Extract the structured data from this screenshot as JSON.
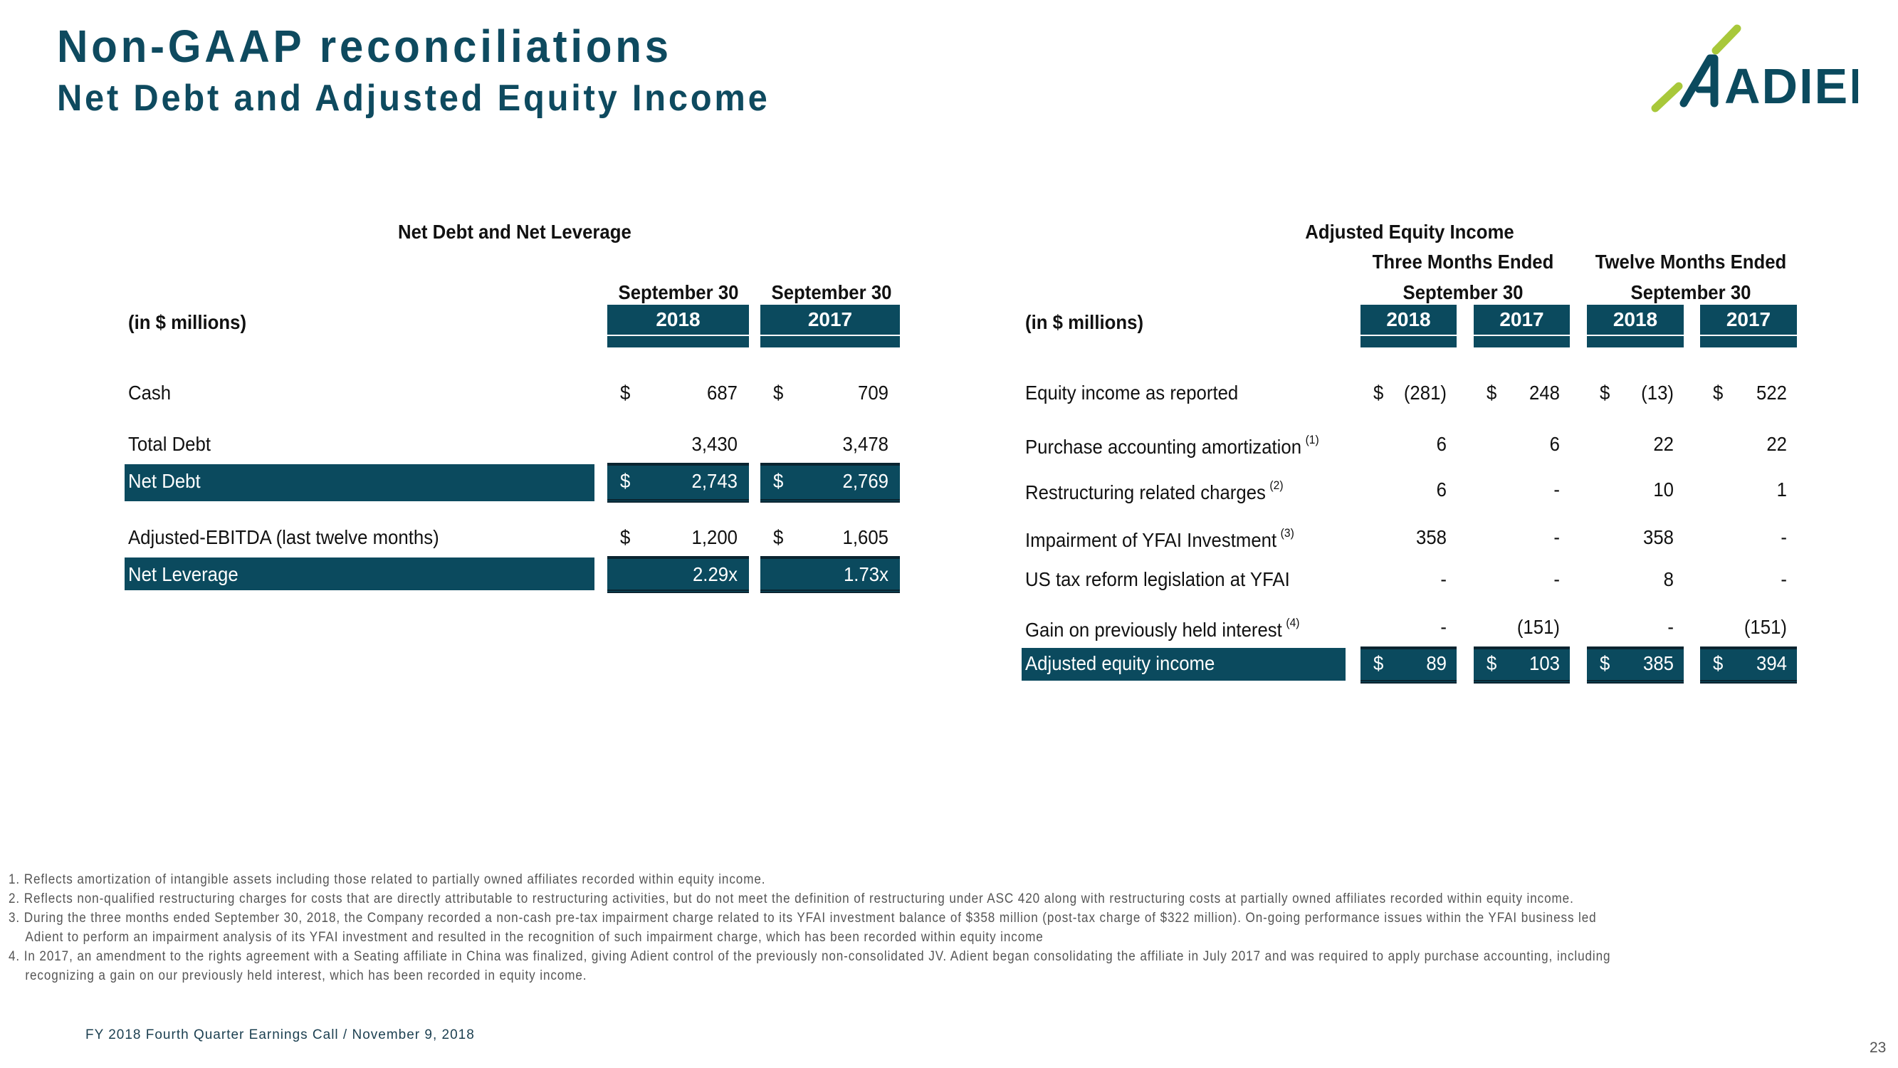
{
  "header": {
    "title": "Non-GAAP reconciliations",
    "subtitle": "Net Debt and Adjusted Equity Income",
    "logo_text": "ADIENT",
    "brand_colors": {
      "navy": "#0b4a5e",
      "lime": "#a8c83a"
    }
  },
  "net_debt": {
    "title": "Net Debt and Net Leverage",
    "units_label": "(in $ millions)",
    "period_label": "September 30",
    "columns": [
      "2018",
      "2017"
    ],
    "rows": [
      {
        "label": "Cash",
        "cells": [
          {
            "cur": "$",
            "val": "687"
          },
          {
            "cur": "$",
            "val": "709"
          }
        ],
        "highlight": false
      },
      {
        "label": "Total Debt",
        "cells": [
          {
            "cur": "",
            "val": "3,430"
          },
          {
            "cur": "",
            "val": "3,478"
          }
        ],
        "highlight": false
      },
      {
        "label": "Net Debt",
        "cells": [
          {
            "cur": "$",
            "val": "2,743"
          },
          {
            "cur": "$",
            "val": "2,769"
          }
        ],
        "highlight": true
      },
      {
        "label": "Adjusted-EBITDA (last twelve months)",
        "cells": [
          {
            "cur": "$",
            "val": "1,200"
          },
          {
            "cur": "$",
            "val": "1,605"
          }
        ],
        "highlight": false
      },
      {
        "label": "Net Leverage",
        "cells": [
          {
            "cur": "",
            "val": "2.29x"
          },
          {
            "cur": "",
            "val": "1.73x"
          }
        ],
        "highlight": true
      }
    ]
  },
  "equity_income": {
    "title": "Adjusted Equity Income",
    "units_label": "(in $ millions)",
    "groups": [
      {
        "label": "Three Months Ended",
        "period": "September 30"
      },
      {
        "label": "Twelve Months Ended",
        "period": "September 30"
      }
    ],
    "columns": [
      "2018",
      "2017",
      "2018",
      "2017"
    ],
    "rows": [
      {
        "label": "Equity income as reported",
        "fn": "",
        "cells": [
          {
            "cur": "$",
            "val": "(281)"
          },
          {
            "cur": "$",
            "val": "248"
          },
          {
            "cur": "$",
            "val": "(13)"
          },
          {
            "cur": "$",
            "val": "522"
          }
        ]
      },
      {
        "label": "Purchase accounting amortization",
        "fn": "(1)",
        "cells": [
          {
            "cur": "",
            "val": "6"
          },
          {
            "cur": "",
            "val": "6"
          },
          {
            "cur": "",
            "val": "22"
          },
          {
            "cur": "",
            "val": "22"
          }
        ]
      },
      {
        "label": "Restructuring related charges",
        "fn": "(2)",
        "cells": [
          {
            "cur": "",
            "val": "6"
          },
          {
            "cur": "",
            "val": "-"
          },
          {
            "cur": "",
            "val": "10"
          },
          {
            "cur": "",
            "val": "1"
          }
        ]
      },
      {
        "label": "Impairment of YFAI Investment",
        "fn": "(3)",
        "cells": [
          {
            "cur": "",
            "val": "358"
          },
          {
            "cur": "",
            "val": "-"
          },
          {
            "cur": "",
            "val": "358"
          },
          {
            "cur": "",
            "val": "-"
          }
        ]
      },
      {
        "label": "US tax reform legislation at YFAI",
        "fn": "",
        "cells": [
          {
            "cur": "",
            "val": "-"
          },
          {
            "cur": "",
            "val": "-"
          },
          {
            "cur": "",
            "val": "8"
          },
          {
            "cur": "",
            "val": "-"
          }
        ]
      },
      {
        "label": "Gain on previously held interest",
        "fn": "(4)",
        "cells": [
          {
            "cur": "",
            "val": "-"
          },
          {
            "cur": "",
            "val": "(151)"
          },
          {
            "cur": "",
            "val": "-"
          },
          {
            "cur": "",
            "val": "(151)"
          }
        ]
      }
    ],
    "total": {
      "label": "Adjusted equity income",
      "cells": [
        {
          "cur": "$",
          "val": "89"
        },
        {
          "cur": "$",
          "val": "103"
        },
        {
          "cur": "$",
          "val": "385"
        },
        {
          "cur": "$",
          "val": "394"
        }
      ]
    }
  },
  "footnotes": [
    "1. Reflects amortization of intangible assets including those related to partially owned affiliates recorded within equity income.",
    "2. Reflects non-qualified restructuring charges for costs that are directly attributable to restructuring activities, but do not meet the definition of restructuring under ASC 420 along with restructuring costs at partially owned affiliates recorded within equity income.",
    "3. During the three months ended September 30, 2018, the Company recorded a non-cash pre-tax impairment charge related to its YFAI investment balance of $358 million (post-tax charge of $322 million). On-going performance issues within the YFAI business led",
    "Adient to perform an impairment analysis of its YFAI investment and resulted in the recognition of such impairment charge, which has been recorded within equity income",
    "4. In 2017, an amendment to the rights agreement with a Seating affiliate in China was finalized, giving Adient control of the previously non-consolidated JV. Adient began consolidating the affiliate in July 2017 and was required to apply purchase accounting, including",
    "recognizing a gain on our previously held interest, which has been recorded in equity income."
  ],
  "footer": {
    "event": "FY 2018 Fourth Quarter Earnings Call / November 9, 2018",
    "page_number": "23"
  }
}
